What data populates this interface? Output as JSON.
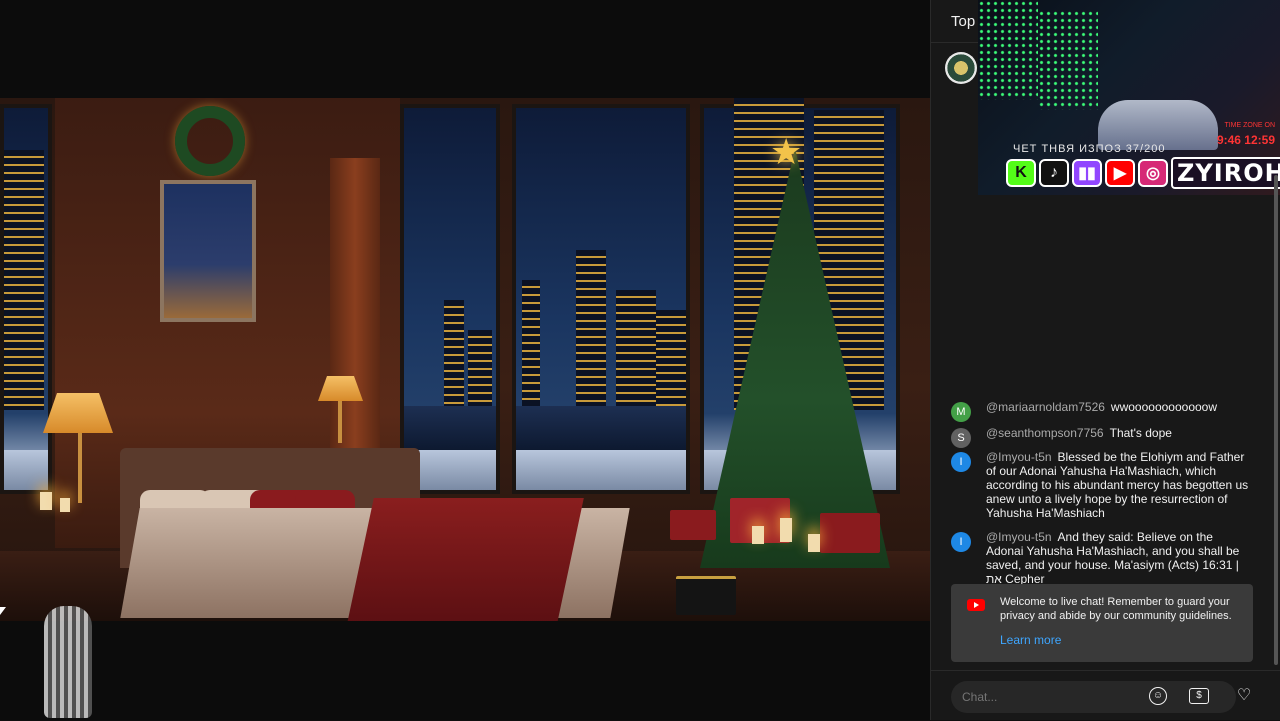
{
  "chat": {
    "header_title": "Top",
    "stream_overlay": {
      "text": "ЧЕТ ТНВЯ ИЗПОЗ 37/200",
      "time_label": "TIME ZONE ON",
      "time": "9:46 12:59",
      "handle": "ZYIROH",
      "social_icons": [
        "kick-icon",
        "tiktok-icon",
        "twitch-icon",
        "youtube-icon",
        "instagram-icon"
      ]
    },
    "messages": [
      {
        "avatar": "M",
        "avatar_color": "#43a047",
        "author": "@mariaarnoldam7526",
        "text": "wwoooooooooooow"
      },
      {
        "avatar": "S",
        "avatar_color": "#616161",
        "author": "@seanthompson7756",
        "text": "That's dope"
      },
      {
        "avatar": "I",
        "avatar_color": "#1e88e5",
        "author": "@Imyou-t5n",
        "text": "Blessed be the Elohiym and Father of our Adonai Yahusha Ha'Mashiach, which according to his abundant mercy has begotten us anew unto a lively hope by the resurrection of Yahusha Ha'Mashiach"
      },
      {
        "avatar": "I",
        "avatar_color": "#1e88e5",
        "author": "@Imyou-t5n",
        "text": "And they said: Believe on the Adonai Yahusha Ha'Mashiach, and you shall be saved, and your house. Ma'asiym (Acts) 16:31 | את Cepher"
      }
    ],
    "welcome": {
      "text": "Welcome to live chat! Remember to guard your privacy and abide by our community guidelines.",
      "link": "Learn more"
    },
    "input": {
      "placeholder": "Chat...",
      "value": ""
    },
    "icons": {
      "emoji": "emoji-icon",
      "super_chat": "dollar-icon",
      "like": "heart-icon"
    }
  },
  "colors": {
    "chat_bg": "#181818",
    "link": "#3ea6ff",
    "accent_red": "#ff0000"
  }
}
